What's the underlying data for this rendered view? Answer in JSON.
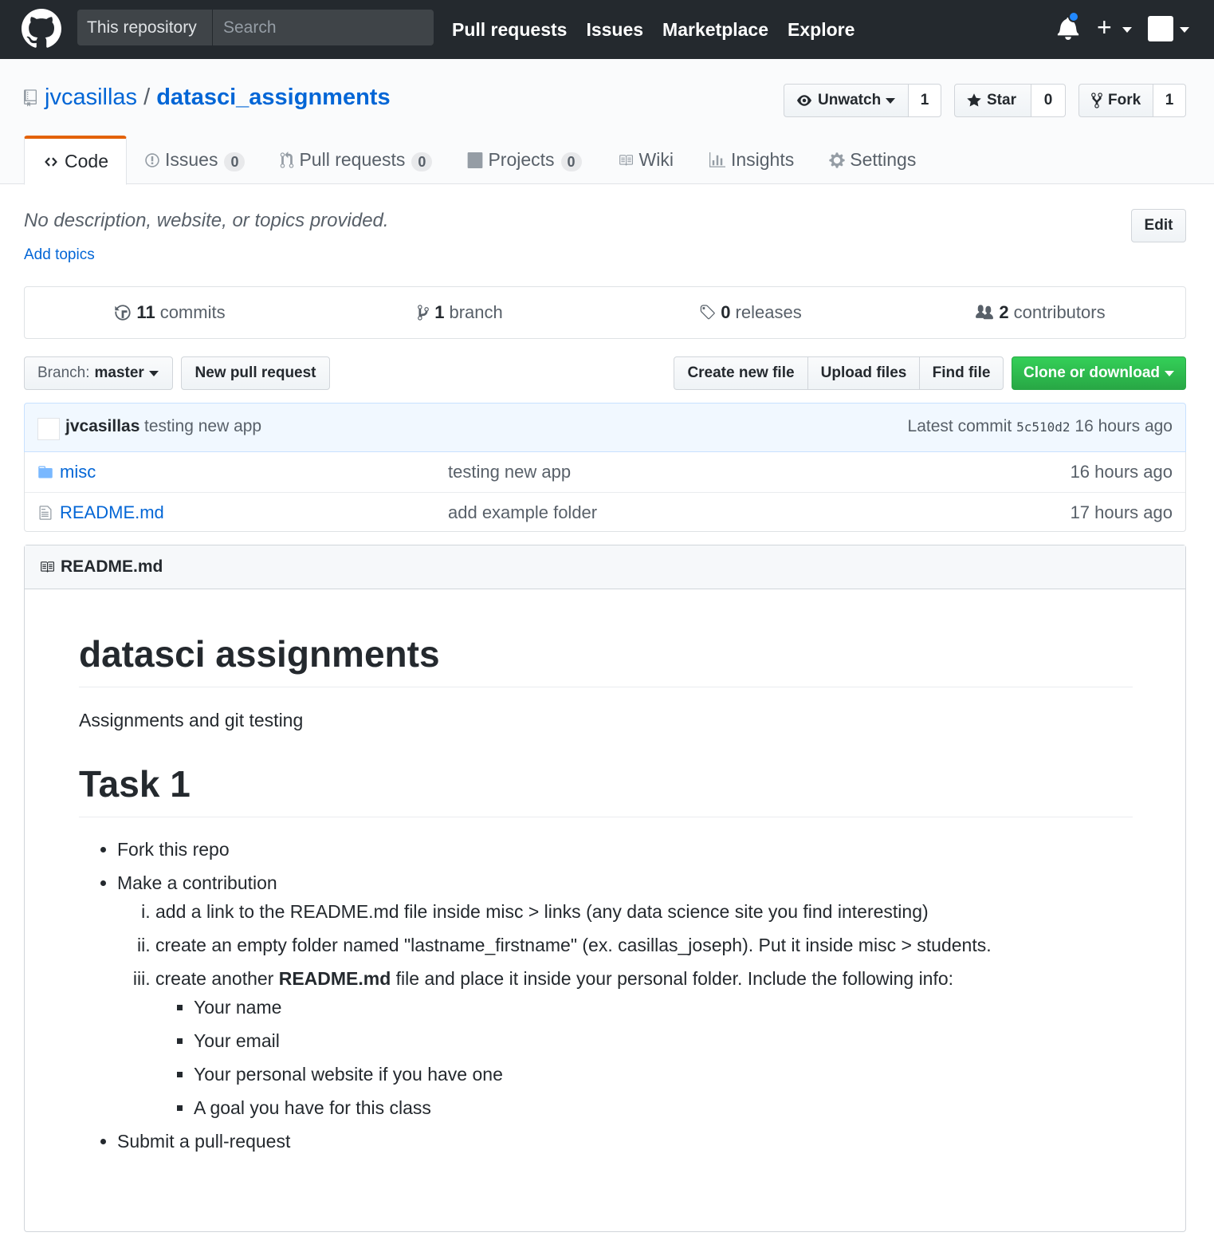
{
  "header": {
    "search_scope": "This repository",
    "search_placeholder": "Search",
    "nav": [
      "Pull requests",
      "Issues",
      "Marketplace",
      "Explore"
    ],
    "plus": "+"
  },
  "repo": {
    "owner": "jvcasillas",
    "separator": "/",
    "name": "datasci_assignments",
    "watch_label": "Unwatch",
    "watch_count": "1",
    "star_label": "Star",
    "star_count": "0",
    "fork_label": "Fork",
    "fork_count": "1"
  },
  "tabs": [
    {
      "label": "Code"
    },
    {
      "label": "Issues",
      "count": "0"
    },
    {
      "label": "Pull requests",
      "count": "0"
    },
    {
      "label": "Projects",
      "count": "0"
    },
    {
      "label": "Wiki"
    },
    {
      "label": "Insights"
    },
    {
      "label": "Settings"
    }
  ],
  "description": "No description, website, or topics provided.",
  "add_topics": "Add topics",
  "edit_label": "Edit",
  "summary": {
    "commits_num": "11",
    "commits_label": "commits",
    "branch_num": "1",
    "branch_label": "branch",
    "releases_num": "0",
    "releases_label": "releases",
    "contributors_num": "2",
    "contributors_label": "contributors"
  },
  "file_nav": {
    "branch_prefix": "Branch:",
    "branch_name": "master",
    "new_pr": "New pull request",
    "create_file": "Create new file",
    "upload_files": "Upload files",
    "find_file": "Find file",
    "clone": "Clone or download"
  },
  "commit": {
    "author": "jvcasillas",
    "message": "testing new app",
    "latest_label": "Latest commit",
    "sha": "5c510d2",
    "age": "16 hours ago"
  },
  "files": [
    {
      "name": "misc",
      "message": "testing new app",
      "age": "16 hours ago",
      "type": "folder"
    },
    {
      "name": "README.md",
      "message": "add example folder",
      "age": "17 hours ago",
      "type": "file"
    }
  ],
  "readme": {
    "title": "README.md",
    "h1": "datasci assignments",
    "intro": "Assignments and git testing",
    "h2": "Task 1",
    "b1": "Fork this repo",
    "b2": "Make a contribution",
    "s1": "add a link to the README.md file inside misc > links (any data science site you find interesting)",
    "s2": "create an empty folder named \"lastname_firstname\" (ex. casillas_joseph). Put it inside misc > students.",
    "s3_pre": "create another ",
    "s3_bold": "README.md",
    "s3_post": " file and place it inside your personal folder. Include the following info:",
    "t1": "Your name",
    "t2": "Your email",
    "t3": "Your personal website if you have one",
    "t4": "A goal you have for this class",
    "b3": "Submit a pull-request"
  }
}
